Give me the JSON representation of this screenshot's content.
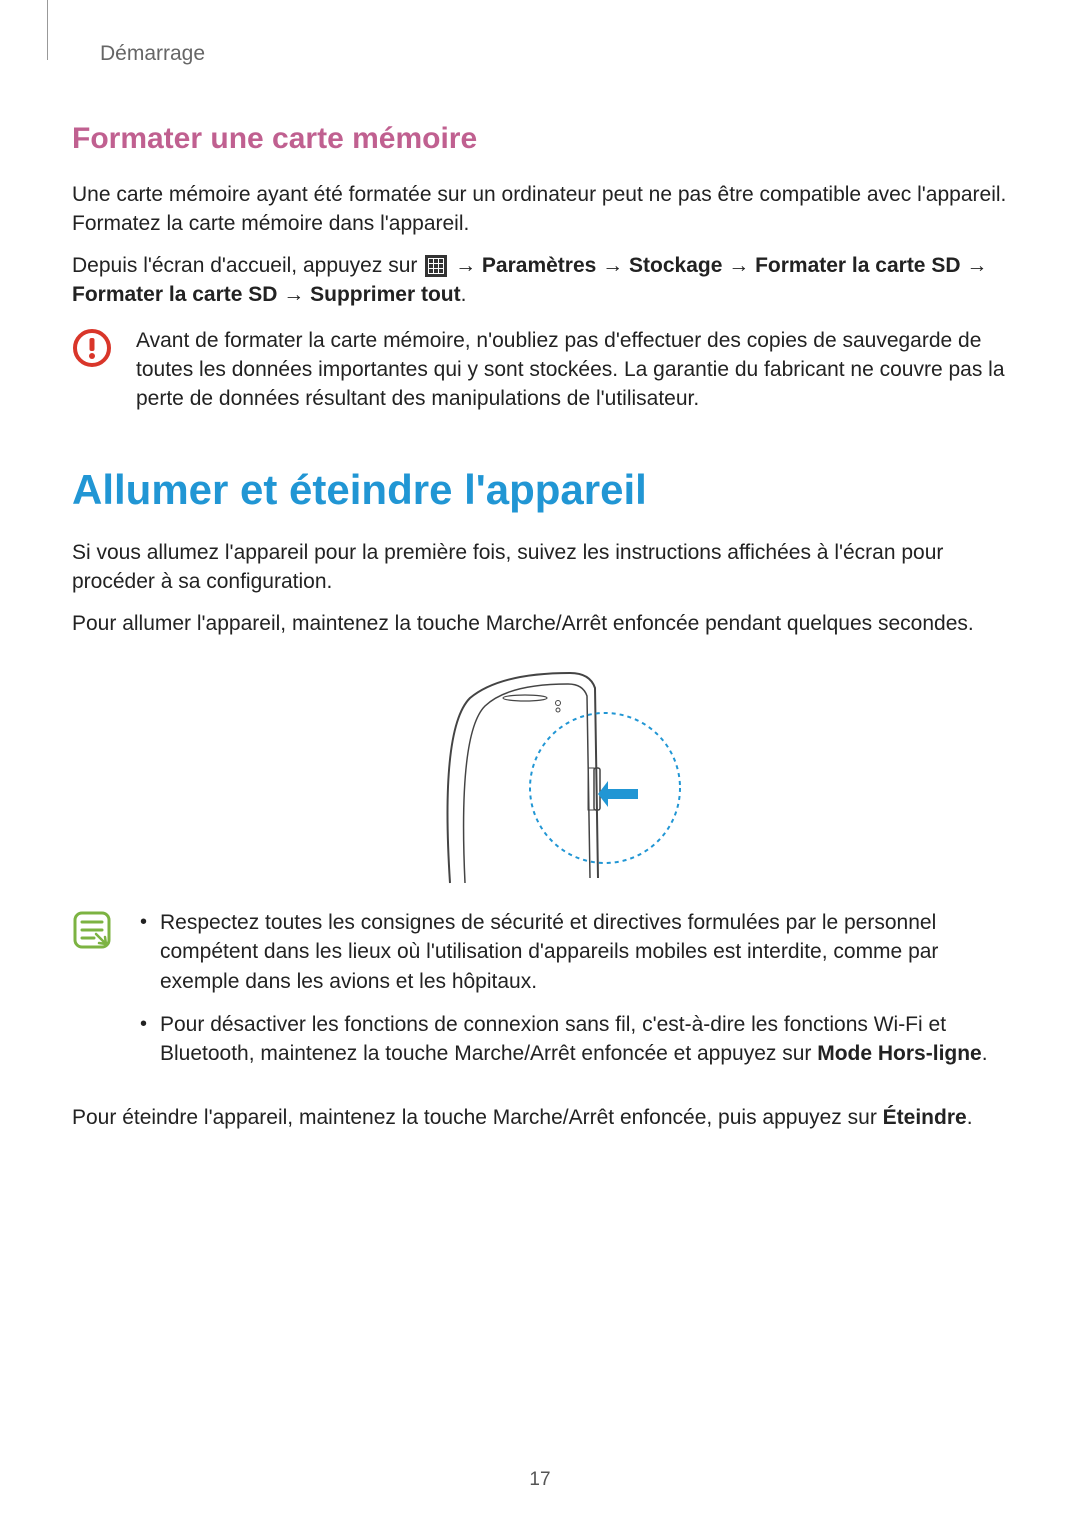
{
  "breadcrumb": "Démarrage",
  "section1": {
    "title": "Formater une carte mémoire",
    "p1": "Une carte mémoire ayant été formatée sur un ordinateur peut ne pas être compatible avec l'appareil. Formatez la carte mémoire dans l'appareil.",
    "p2_prefix": "Depuis l'écran d'accueil, appuyez sur ",
    "path_seg1": "Paramètres",
    "path_seg2": "Stockage",
    "path_seg3": "Formater la carte SD",
    "path_seg4": "Formater la carte SD",
    "path_seg5": "Supprimer tout",
    "arrow": "→",
    "warning": "Avant de formater la carte mémoire, n'oubliez pas d'effectuer des copies de sauvegarde de toutes les données importantes qui y sont stockées. La garantie du fabricant ne couvre pas la perte de données résultant des manipulations de l'utilisateur."
  },
  "section2": {
    "title": "Allumer et éteindre l'appareil",
    "p1": "Si vous allumez l'appareil pour la première fois, suivez les instructions affichées à l'écran pour procéder à sa configuration.",
    "p2": "Pour allumer l'appareil, maintenez la touche Marche/Arrêt enfoncée pendant quelques secondes.",
    "note_li1": "Respectez toutes les consignes de sécurité et directives formulées par le personnel compétent dans les lieux où l'utilisation d'appareils mobiles est interdite, comme par exemple dans les avions et les hôpitaux.",
    "note_li2_prefix": "Pour désactiver les fonctions de connexion sans fil, c'est-à-dire les fonctions Wi-Fi et Bluetooth, maintenez la touche Marche/Arrêt enfoncée et appuyez sur ",
    "note_li2_bold": "Mode Hors-ligne",
    "note_li2_suffix": ".",
    "p3_prefix": "Pour éteindre l'appareil, maintenez la touche Marche/Arrêt enfoncée, puis appuyez sur ",
    "p3_bold": "Éteindre",
    "p3_suffix": "."
  },
  "page_number": "17"
}
